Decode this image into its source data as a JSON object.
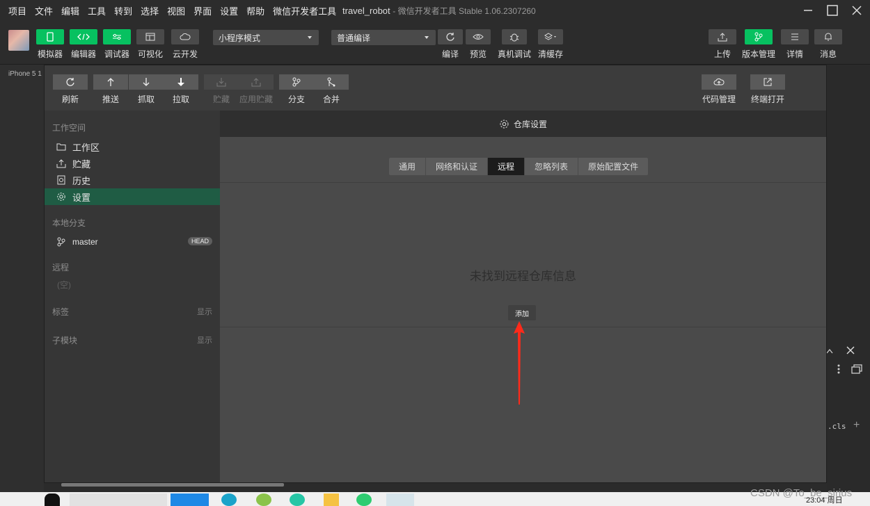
{
  "menu": [
    "项目",
    "文件",
    "编辑",
    "工具",
    "转到",
    "选择",
    "视图",
    "界面",
    "设置",
    "帮助",
    "微信开发者工具"
  ],
  "window": {
    "title": "travel_robot",
    "subtitle": "- 微信开发者工具 Stable 1.06.2307260"
  },
  "toolbar": {
    "left_buttons": [
      "模拟器",
      "编辑器",
      "调试器",
      "可视化",
      "云开发"
    ],
    "mode_select": "小程序模式",
    "compile_select": "普通编译",
    "middle_buttons": [
      "编译",
      "预览",
      "真机调试",
      "清缓存"
    ],
    "right_buttons": [
      "上传",
      "版本管理",
      "详情",
      "消息"
    ]
  },
  "device_label": "iPhone 5 1",
  "vc_toolbar": {
    "buttons": [
      "刷新",
      "推送",
      "抓取",
      "拉取",
      "贮藏",
      "应用贮藏",
      "分支",
      "合并"
    ],
    "right_buttons": [
      "代码管理",
      "终端打开"
    ]
  },
  "sidebar": {
    "workspace_title": "工作空间",
    "workspace_items": [
      "工作区",
      "贮藏",
      "历史",
      "设置"
    ],
    "local_branch_title": "本地分支",
    "branch": "master",
    "branch_badge": "HEAD",
    "remote_title": "远程",
    "remote_empty": "(空)",
    "tags_title": "标签",
    "tags_action": "显示",
    "submodule_title": "子模块",
    "submodule_action": "显示"
  },
  "content": {
    "header": "仓库设置",
    "tabs": [
      "通用",
      "网络和认证",
      "远程",
      "忽略列表",
      "原始配置文件"
    ],
    "active_tab": "远程",
    "empty_message": "未找到远程仓库信息",
    "add_button": "添加"
  },
  "devtools": {
    "cls_label": ".cls"
  },
  "taskbar": {
    "watermark": "CSDN @To_be_sirius",
    "clock": "23:04 周日"
  },
  "colors": {
    "accent_green": "#07c160",
    "active_item": "#1f5c44",
    "arrow_red": "#ff2a1a"
  }
}
